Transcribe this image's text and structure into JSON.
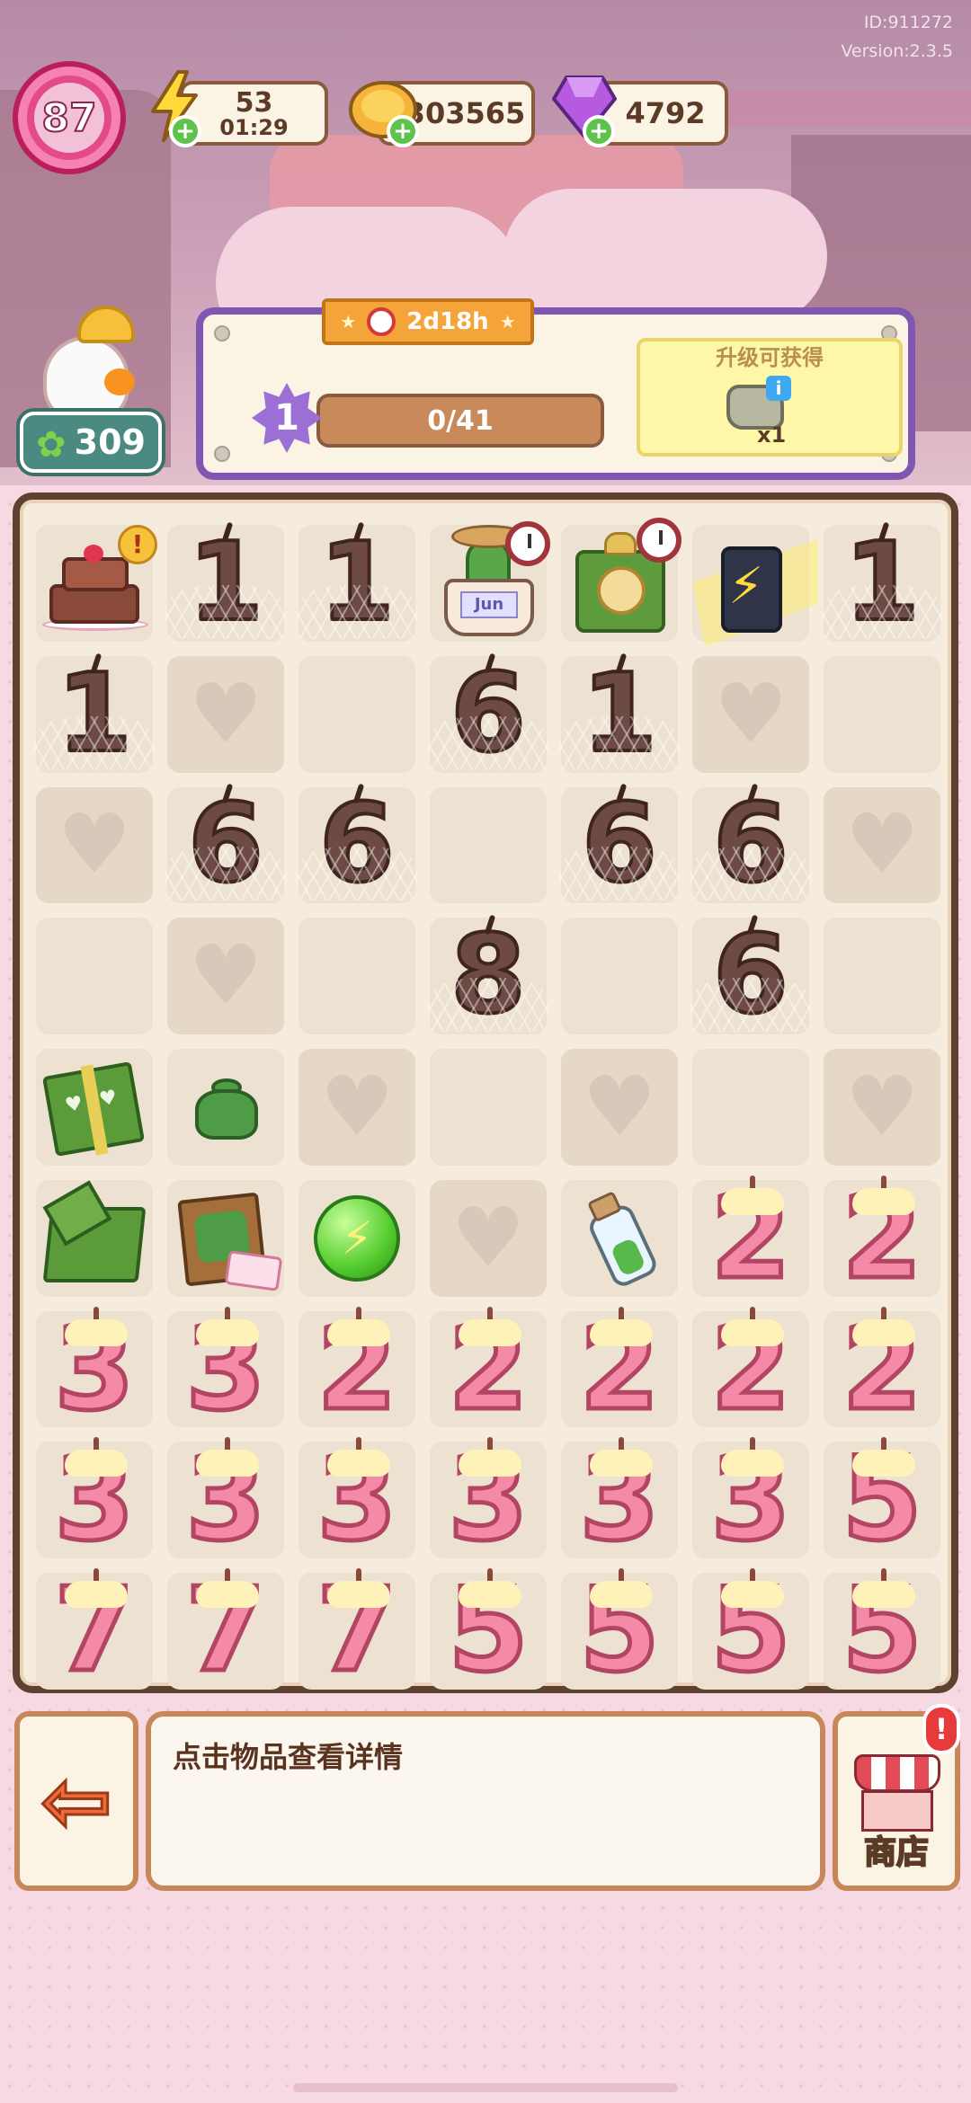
{
  "meta": {
    "id": "ID:911272",
    "version": "Version:2.3.5"
  },
  "player": {
    "level": "87"
  },
  "currency": {
    "energy": "53",
    "energy_timer": "01:29",
    "coins": "303565",
    "gems": "4792"
  },
  "stars": "309",
  "quest": {
    "timer": "2d18h",
    "level": "1",
    "progress": "0/41",
    "reward_title": "升级可获得",
    "reward_count": "x1"
  },
  "board": {
    "rows": [
      [
        "cake",
        "web:1",
        "web:1",
        "pot",
        "clock",
        "battery",
        "web:1"
      ],
      [
        "web:1",
        "heart",
        "empty",
        "web:6",
        "web:1",
        "heart",
        "empty"
      ],
      [
        "heart",
        "web:6",
        "web:6",
        "empty",
        "web:6",
        "web:6",
        "heart"
      ],
      [
        "empty",
        "heart",
        "empty",
        "web:8",
        "empty",
        "web:6",
        "empty"
      ],
      [
        "gift",
        "sack",
        "heart",
        "empty",
        "heart",
        "empty",
        "heart"
      ],
      [
        "opengift",
        "crate",
        "orb",
        "heart",
        "bottle",
        "num:2",
        "num:2"
      ],
      [
        "num:3",
        "num:3",
        "num:2",
        "num:2",
        "num:2",
        "num:2",
        "num:2"
      ],
      [
        "num:3",
        "num:3",
        "num:3",
        "num:3",
        "num:3",
        "num:3",
        "num:5"
      ],
      [
        "num:7",
        "num:7",
        "num:7",
        "num:5",
        "num:5",
        "num:5",
        "num:5"
      ]
    ],
    "badges": {
      "cake": "!",
      "pot_timer": true,
      "clock_timer": true
    },
    "pot_label": "Jun"
  },
  "info_text": "点击物品查看详情",
  "shop": {
    "label": "商店",
    "alert": "!"
  },
  "colors": {
    "accent_purple": "#8056b3",
    "candle_pink": "#f48aa6",
    "frame_brown": "#5f4131"
  }
}
